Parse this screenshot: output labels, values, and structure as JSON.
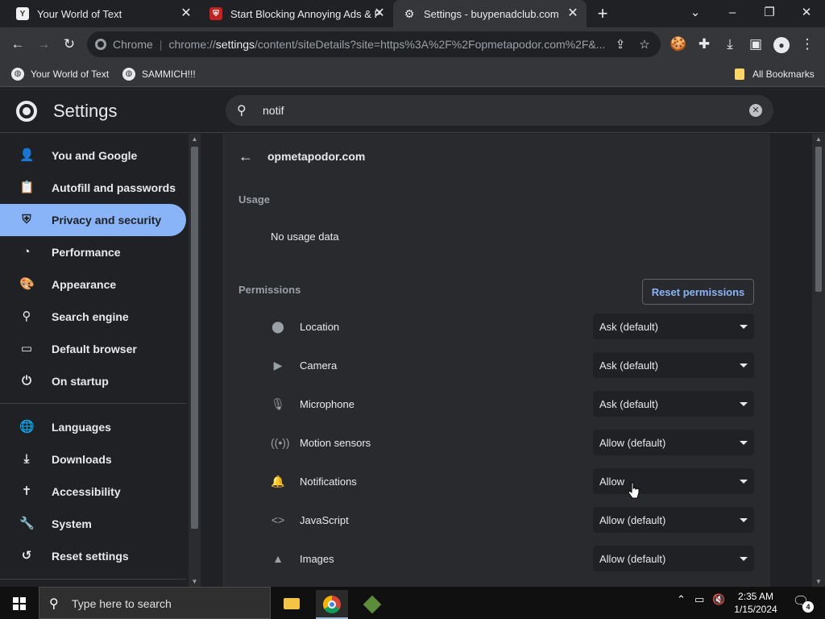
{
  "tabs": [
    {
      "title": "Your World of Text",
      "favicon": "Y"
    },
    {
      "title": "Start Blocking Annoying Ads & P",
      "favicon": "shield-icon"
    },
    {
      "title": "Settings - buypenadclub.com",
      "favicon": "gear-icon",
      "active": true
    }
  ],
  "toolbar": {
    "chip": "Chrome",
    "url_scheme": "chrome://",
    "url_host": "settings",
    "url_path": "/content/siteDetails?site=https%3A%2F%2Fopmetapodor.com%2F&..."
  },
  "bookmarks": [
    {
      "label": "Your World of Text"
    },
    {
      "label": "SAMMICH!!!"
    }
  ],
  "bookmarks_all": "All Bookmarks",
  "settings": {
    "title": "Settings",
    "search_value": "notif"
  },
  "sidebar": {
    "items": [
      {
        "label": "You and Google",
        "icon": "person-icon"
      },
      {
        "label": "Autofill and passwords",
        "icon": "clipboard-icon"
      },
      {
        "label": "Privacy and security",
        "icon": "shield-icon",
        "active": true
      },
      {
        "label": "Performance",
        "icon": "gauge-icon"
      },
      {
        "label": "Appearance",
        "icon": "palette-icon"
      },
      {
        "label": "Search engine",
        "icon": "search-icon"
      },
      {
        "label": "Default browser",
        "icon": "browser-icon"
      },
      {
        "label": "On startup",
        "icon": "power-icon"
      },
      {
        "label": "Languages",
        "icon": "globe-icon"
      },
      {
        "label": "Downloads",
        "icon": "download-icon"
      },
      {
        "label": "Accessibility",
        "icon": "accessibility-icon"
      },
      {
        "label": "System",
        "icon": "wrench-icon"
      },
      {
        "label": "Reset settings",
        "icon": "history-icon"
      }
    ]
  },
  "site": {
    "name": "opmetapodor.com",
    "usage_heading": "Usage",
    "usage_value": "No usage data",
    "permissions_heading": "Permissions",
    "reset_label": "Reset permissions",
    "permissions": [
      {
        "label": "Location",
        "value": "Ask (default)",
        "icon": "location-pin-icon"
      },
      {
        "label": "Camera",
        "value": "Ask (default)",
        "icon": "camera-icon"
      },
      {
        "label": "Microphone",
        "value": "Ask (default)",
        "icon": "microphone-icon"
      },
      {
        "label": "Motion sensors",
        "value": "Allow (default)",
        "icon": "motion-sensor-icon"
      },
      {
        "label": "Notifications",
        "value": "Allow",
        "icon": "bell-icon"
      },
      {
        "label": "JavaScript",
        "value": "Allow (default)",
        "icon": "code-icon"
      },
      {
        "label": "Images",
        "value": "Allow (default)",
        "icon": "image-icon"
      }
    ]
  },
  "taskbar": {
    "search_placeholder": "Type here to search",
    "time": "2:35 AM",
    "date": "1/15/2024",
    "notification_count": "4"
  }
}
